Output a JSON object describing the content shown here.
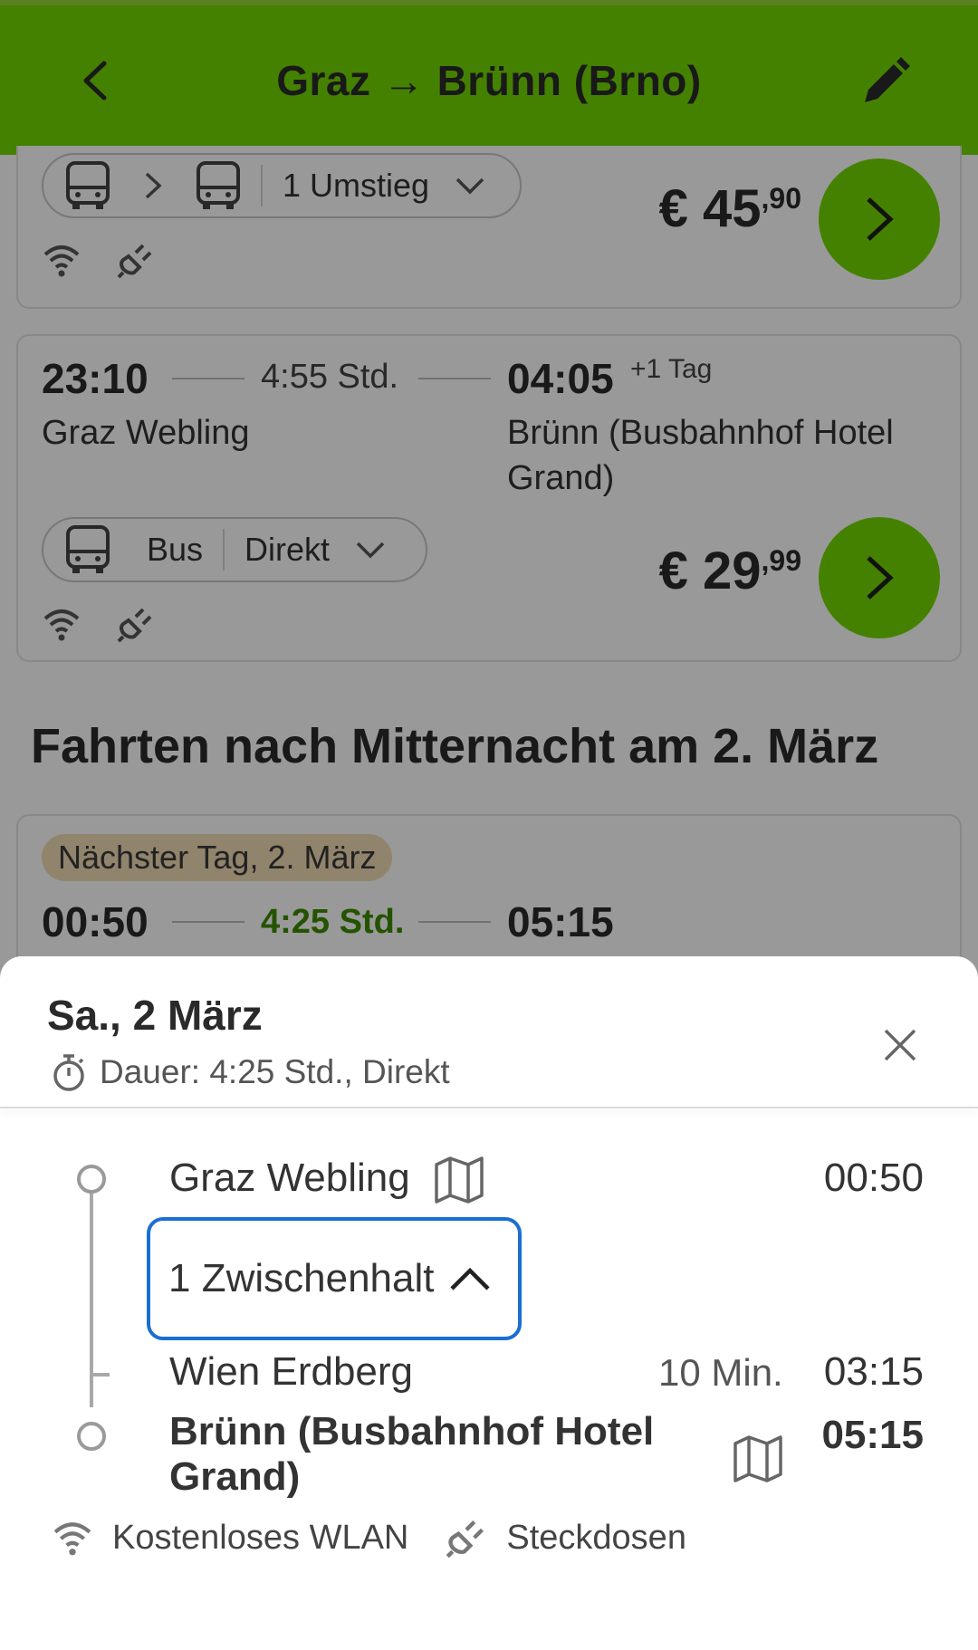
{
  "header": {
    "title": "Graz → Brünn (Brno)"
  },
  "card1": {
    "transfer_label": "1 Umstieg",
    "price_main": "€ 45",
    "price_cents": ",90"
  },
  "card2": {
    "dep_time": "23:10",
    "duration": "4:55 Std.",
    "arr_time": "04:05",
    "plus_day": "+1 Tag",
    "from": "Graz Webling",
    "to": "Brünn (Busbahnhof Hotel Grand)",
    "mode_label": "Bus",
    "direct_label": "Direkt",
    "price_main": "€ 29",
    "price_cents": ",99"
  },
  "section": {
    "title": "Fahrten nach Mitternacht am 2. März"
  },
  "card3": {
    "badge": "Nächster Tag, 2. März",
    "dep_time": "00:50",
    "duration": "4:25 Std.",
    "arr_time": "05:15"
  },
  "sheet": {
    "date": "Sa., 2 März",
    "duration_text": "Dauer: 4:25 Std., Direkt",
    "stops": [
      {
        "name": "Graz Webling",
        "time": "00:50"
      },
      {
        "name": "Wien Erdberg",
        "wait": "10 Min.",
        "time": "03:15"
      },
      {
        "name": "Brünn (Busbahnhof Hotel Grand)",
        "time": "05:15"
      }
    ],
    "intermediate_label": "1 Zwischenhalt",
    "amenities": {
      "wifi": "Kostenloses WLAN",
      "power": "Steckdosen"
    }
  },
  "colors": {
    "brand_green": "#73d700",
    "focus_blue": "#1a6fd1",
    "duration_green": "#3d8b00",
    "badge_bg": "#f2dcb4"
  },
  "icons": [
    "back-arrow-icon",
    "edit-pencil-icon",
    "bus-icon",
    "chevron-right-icon",
    "chevron-down-icon",
    "wifi-icon",
    "plug-icon",
    "timer-icon",
    "close-icon",
    "map-icon",
    "chevron-up-icon"
  ]
}
